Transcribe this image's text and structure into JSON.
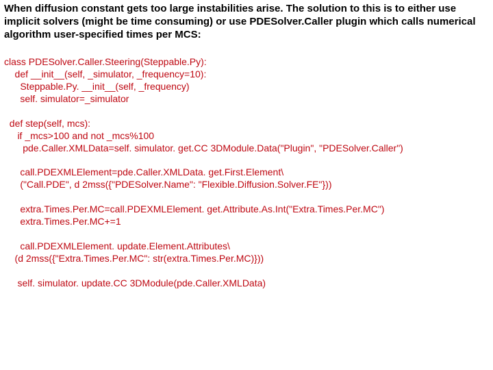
{
  "intro": "When diffusion constant gets too large instabilities arise. The solution to this is to either use implicit solvers (might be time consuming) or use PDESolver.Caller plugin which calls numerical algorithm user-specified times per MCS:",
  "code": "class PDESolver.Caller.Steering(Steppable.Py):\n    def __init__(self, _simulator, _frequency=10):\n      Steppable.Py. __init__(self, _frequency)\n      self. simulator=_simulator\n\n  def step(self, mcs):\n     if _mcs>100 and not _mcs%100\n       pde.Caller.XMLData=self. simulator. get.CC 3DModule.Data(\"Plugin\", \"PDESolver.Caller\")\n\n      call.PDEXMLElement=pde.Caller.XMLData. get.First.Element\\\n      (\"Call.PDE\", d 2mss({\"PDESolver.Name\": \"Flexible.Diffusion.Solver.FE\"}))\n\n      extra.Times.Per.MC=call.PDEXMLElement. get.Attribute.As.Int(\"Extra.Times.Per.MC\")\n      extra.Times.Per.MC+=1\n\n      call.PDEXMLElement. update.Element.Attributes\\\n    (d 2mss({\"Extra.Times.Per.MC\": str(extra.Times.Per.MC)}))\n\n     self. simulator. update.CC 3DModule(pde.Caller.XMLData)"
}
